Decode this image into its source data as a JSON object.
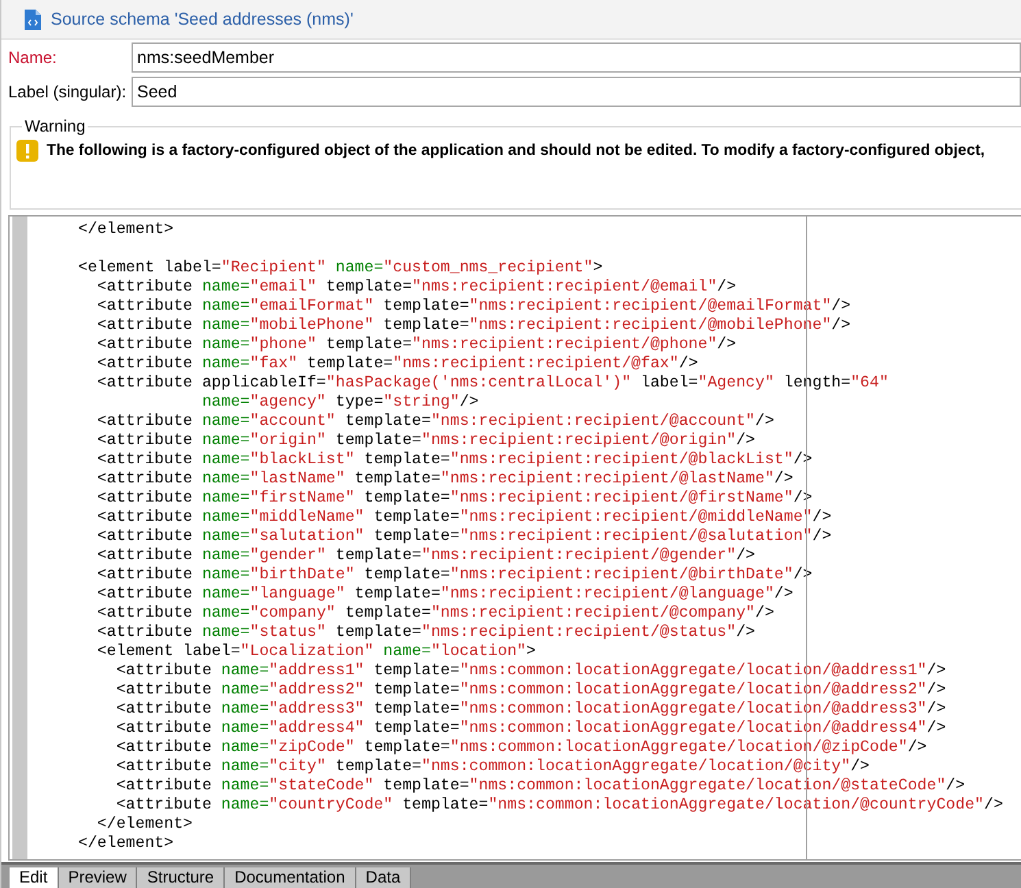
{
  "header": {
    "title": "Source schema 'Seed addresses (nms)'"
  },
  "fields": [
    {
      "label": "Name:",
      "value": "nms:seedMember",
      "required": true
    },
    {
      "label": "Label (singular):",
      "value": "Seed",
      "required": false
    }
  ],
  "warning": {
    "legend": "Warning",
    "message": "The following is a factory-configured object of the application and should not be edited. To modify a factory-configured object,"
  },
  "code_lines": [
    {
      "kind": "code",
      "segments": [
        {
          "text": "</element>",
          "kind": "tag"
        }
      ]
    },
    {
      "kind": "blank"
    },
    {
      "kind": "code",
      "segments": [
        {
          "text": "<element label=",
          "kind": "tag"
        },
        {
          "text": "\"Recipient\"",
          "kind": "value"
        },
        {
          "text": " name=",
          "kind": "name"
        },
        {
          "text": "\"custom_nms_recipient\"",
          "kind": "value"
        },
        {
          "text": ">",
          "kind": "tag"
        }
      ]
    },
    {
      "kind": "code",
      "segments": [
        {
          "text": "  <attribute ",
          "kind": "tag"
        },
        {
          "text": "name=",
          "kind": "name"
        },
        {
          "text": "\"email\"",
          "kind": "value"
        },
        {
          "text": " template=",
          "kind": "tag"
        },
        {
          "text": "\"nms:recipient:recipient/@email\"",
          "kind": "value"
        },
        {
          "text": "/>",
          "kind": "tag"
        }
      ]
    },
    {
      "kind": "code",
      "segments": [
        {
          "text": "  <attribute ",
          "kind": "tag"
        },
        {
          "text": "name=",
          "kind": "name"
        },
        {
          "text": "\"emailFormat\"",
          "kind": "value"
        },
        {
          "text": " template=",
          "kind": "tag"
        },
        {
          "text": "\"nms:recipient:recipient/@emailFormat\"",
          "kind": "value"
        },
        {
          "text": "/>",
          "kind": "tag"
        }
      ]
    },
    {
      "kind": "code",
      "segments": [
        {
          "text": "  <attribute ",
          "kind": "tag"
        },
        {
          "text": "name=",
          "kind": "name"
        },
        {
          "text": "\"mobilePhone\"",
          "kind": "value"
        },
        {
          "text": " template=",
          "kind": "tag"
        },
        {
          "text": "\"nms:recipient:recipient/@mobilePhone\"",
          "kind": "value"
        },
        {
          "text": "/>",
          "kind": "tag"
        }
      ]
    },
    {
      "kind": "code",
      "segments": [
        {
          "text": "  <attribute ",
          "kind": "tag"
        },
        {
          "text": "name=",
          "kind": "name"
        },
        {
          "text": "\"phone\"",
          "kind": "value"
        },
        {
          "text": " template=",
          "kind": "tag"
        },
        {
          "text": "\"nms:recipient:recipient/@phone\"",
          "kind": "value"
        },
        {
          "text": "/>",
          "kind": "tag"
        }
      ]
    },
    {
      "kind": "code",
      "segments": [
        {
          "text": "  <attribute ",
          "kind": "tag"
        },
        {
          "text": "name=",
          "kind": "name"
        },
        {
          "text": "\"fax\"",
          "kind": "value"
        },
        {
          "text": " template=",
          "kind": "tag"
        },
        {
          "text": "\"nms:recipient:recipient/@fax\"",
          "kind": "value"
        },
        {
          "text": "/>",
          "kind": "tag"
        }
      ]
    },
    {
      "kind": "code",
      "segments": [
        {
          "text": "  <attribute applicableIf=",
          "kind": "tag"
        },
        {
          "text": "\"hasPackage('nms:centralLocal')\"",
          "kind": "value"
        },
        {
          "text": " label=",
          "kind": "tag"
        },
        {
          "text": "\"Agency\"",
          "kind": "value"
        },
        {
          "text": " length=",
          "kind": "tag"
        },
        {
          "text": "\"64\"",
          "kind": "value"
        }
      ]
    },
    {
      "kind": "code",
      "segments": [
        {
          "text": "             name=",
          "kind": "name"
        },
        {
          "text": "\"agency\"",
          "kind": "value"
        },
        {
          "text": " type=",
          "kind": "tag"
        },
        {
          "text": "\"string\"",
          "kind": "value"
        },
        {
          "text": "/>",
          "kind": "tag"
        }
      ]
    },
    {
      "kind": "code",
      "segments": [
        {
          "text": "  <attribute ",
          "kind": "tag"
        },
        {
          "text": "name=",
          "kind": "name"
        },
        {
          "text": "\"account\"",
          "kind": "value"
        },
        {
          "text": " template=",
          "kind": "tag"
        },
        {
          "text": "\"nms:recipient:recipient/@account\"",
          "kind": "value"
        },
        {
          "text": "/>",
          "kind": "tag"
        }
      ]
    },
    {
      "kind": "code",
      "segments": [
        {
          "text": "  <attribute ",
          "kind": "tag"
        },
        {
          "text": "name=",
          "kind": "name"
        },
        {
          "text": "\"origin\"",
          "kind": "value"
        },
        {
          "text": " template=",
          "kind": "tag"
        },
        {
          "text": "\"nms:recipient:recipient/@origin\"",
          "kind": "value"
        },
        {
          "text": "/>",
          "kind": "tag"
        }
      ]
    },
    {
      "kind": "code",
      "segments": [
        {
          "text": "  <attribute ",
          "kind": "tag"
        },
        {
          "text": "name=",
          "kind": "name"
        },
        {
          "text": "\"blackList\"",
          "kind": "value"
        },
        {
          "text": " template=",
          "kind": "tag"
        },
        {
          "text": "\"nms:recipient:recipient/@blackList\"",
          "kind": "value"
        },
        {
          "text": "/>",
          "kind": "tag"
        }
      ]
    },
    {
      "kind": "code",
      "segments": [
        {
          "text": "  <attribute ",
          "kind": "tag"
        },
        {
          "text": "name=",
          "kind": "name"
        },
        {
          "text": "\"lastName\"",
          "kind": "value"
        },
        {
          "text": " template=",
          "kind": "tag"
        },
        {
          "text": "\"nms:recipient:recipient/@lastName\"",
          "kind": "value"
        },
        {
          "text": "/>",
          "kind": "tag"
        }
      ]
    },
    {
      "kind": "code",
      "segments": [
        {
          "text": "  <attribute ",
          "kind": "tag"
        },
        {
          "text": "name=",
          "kind": "name"
        },
        {
          "text": "\"firstName\"",
          "kind": "value"
        },
        {
          "text": " template=",
          "kind": "tag"
        },
        {
          "text": "\"nms:recipient:recipient/@firstName\"",
          "kind": "value"
        },
        {
          "text": "/>",
          "kind": "tag"
        }
      ]
    },
    {
      "kind": "code",
      "segments": [
        {
          "text": "  <attribute ",
          "kind": "tag"
        },
        {
          "text": "name=",
          "kind": "name"
        },
        {
          "text": "\"middleName\"",
          "kind": "value"
        },
        {
          "text": " template=",
          "kind": "tag"
        },
        {
          "text": "\"nms:recipient:recipient/@middleName\"",
          "kind": "value"
        },
        {
          "text": "/>",
          "kind": "tag"
        }
      ]
    },
    {
      "kind": "code",
      "segments": [
        {
          "text": "  <attribute ",
          "kind": "tag"
        },
        {
          "text": "name=",
          "kind": "name"
        },
        {
          "text": "\"salutation\"",
          "kind": "value"
        },
        {
          "text": " template=",
          "kind": "tag"
        },
        {
          "text": "\"nms:recipient:recipient/@salutation\"",
          "kind": "value"
        },
        {
          "text": "/>",
          "kind": "tag"
        }
      ]
    },
    {
      "kind": "code",
      "segments": [
        {
          "text": "  <attribute ",
          "kind": "tag"
        },
        {
          "text": "name=",
          "kind": "name"
        },
        {
          "text": "\"gender\"",
          "kind": "value"
        },
        {
          "text": " template=",
          "kind": "tag"
        },
        {
          "text": "\"nms:recipient:recipient/@gender\"",
          "kind": "value"
        },
        {
          "text": "/>",
          "kind": "tag"
        }
      ]
    },
    {
      "kind": "code",
      "segments": [
        {
          "text": "  <attribute ",
          "kind": "tag"
        },
        {
          "text": "name=",
          "kind": "name"
        },
        {
          "text": "\"birthDate\"",
          "kind": "value"
        },
        {
          "text": " template=",
          "kind": "tag"
        },
        {
          "text": "\"nms:recipient:recipient/@birthDate\"",
          "kind": "value"
        },
        {
          "text": "/>",
          "kind": "tag"
        }
      ]
    },
    {
      "kind": "code",
      "segments": [
        {
          "text": "  <attribute ",
          "kind": "tag"
        },
        {
          "text": "name=",
          "kind": "name"
        },
        {
          "text": "\"language\"",
          "kind": "value"
        },
        {
          "text": " template=",
          "kind": "tag"
        },
        {
          "text": "\"nms:recipient:recipient/@language\"",
          "kind": "value"
        },
        {
          "text": "/>",
          "kind": "tag"
        }
      ]
    },
    {
      "kind": "code",
      "segments": [
        {
          "text": "  <attribute ",
          "kind": "tag"
        },
        {
          "text": "name=",
          "kind": "name"
        },
        {
          "text": "\"company\"",
          "kind": "value"
        },
        {
          "text": " template=",
          "kind": "tag"
        },
        {
          "text": "\"nms:recipient:recipient/@company\"",
          "kind": "value"
        },
        {
          "text": "/>",
          "kind": "tag"
        }
      ]
    },
    {
      "kind": "code",
      "segments": [
        {
          "text": "  <attribute ",
          "kind": "tag"
        },
        {
          "text": "name=",
          "kind": "name"
        },
        {
          "text": "\"status\"",
          "kind": "value"
        },
        {
          "text": " template=",
          "kind": "tag"
        },
        {
          "text": "\"nms:recipient:recipient/@status\"",
          "kind": "value"
        },
        {
          "text": "/>",
          "kind": "tag"
        }
      ]
    },
    {
      "kind": "code",
      "segments": [
        {
          "text": "  <element label=",
          "kind": "tag"
        },
        {
          "text": "\"Localization\"",
          "kind": "value"
        },
        {
          "text": " name=",
          "kind": "name"
        },
        {
          "text": "\"location\"",
          "kind": "value"
        },
        {
          "text": ">",
          "kind": "tag"
        }
      ]
    },
    {
      "kind": "code",
      "segments": [
        {
          "text": "    <attribute ",
          "kind": "tag"
        },
        {
          "text": "name=",
          "kind": "name"
        },
        {
          "text": "\"address1\"",
          "kind": "value"
        },
        {
          "text": " template=",
          "kind": "tag"
        },
        {
          "text": "\"nms:common:locationAggregate/location/@address1\"",
          "kind": "value"
        },
        {
          "text": "/>",
          "kind": "tag"
        }
      ]
    },
    {
      "kind": "code",
      "segments": [
        {
          "text": "    <attribute ",
          "kind": "tag"
        },
        {
          "text": "name=",
          "kind": "name"
        },
        {
          "text": "\"address2\"",
          "kind": "value"
        },
        {
          "text": " template=",
          "kind": "tag"
        },
        {
          "text": "\"nms:common:locationAggregate/location/@address2\"",
          "kind": "value"
        },
        {
          "text": "/>",
          "kind": "tag"
        }
      ]
    },
    {
      "kind": "code",
      "segments": [
        {
          "text": "    <attribute ",
          "kind": "tag"
        },
        {
          "text": "name=",
          "kind": "name"
        },
        {
          "text": "\"address3\"",
          "kind": "value"
        },
        {
          "text": " template=",
          "kind": "tag"
        },
        {
          "text": "\"nms:common:locationAggregate/location/@address3\"",
          "kind": "value"
        },
        {
          "text": "/>",
          "kind": "tag"
        }
      ]
    },
    {
      "kind": "code",
      "segments": [
        {
          "text": "    <attribute ",
          "kind": "tag"
        },
        {
          "text": "name=",
          "kind": "name"
        },
        {
          "text": "\"address4\"",
          "kind": "value"
        },
        {
          "text": " template=",
          "kind": "tag"
        },
        {
          "text": "\"nms:common:locationAggregate/location/@address4\"",
          "kind": "value"
        },
        {
          "text": "/>",
          "kind": "tag"
        }
      ]
    },
    {
      "kind": "code",
      "segments": [
        {
          "text": "    <attribute ",
          "kind": "tag"
        },
        {
          "text": "name=",
          "kind": "name"
        },
        {
          "text": "\"zipCode\"",
          "kind": "value"
        },
        {
          "text": " template=",
          "kind": "tag"
        },
        {
          "text": "\"nms:common:locationAggregate/location/@zipCode\"",
          "kind": "value"
        },
        {
          "text": "/>",
          "kind": "tag"
        }
      ]
    },
    {
      "kind": "code",
      "segments": [
        {
          "text": "    <attribute ",
          "kind": "tag"
        },
        {
          "text": "name=",
          "kind": "name"
        },
        {
          "text": "\"city\"",
          "kind": "value"
        },
        {
          "text": " template=",
          "kind": "tag"
        },
        {
          "text": "\"nms:common:locationAggregate/location/@city\"",
          "kind": "value"
        },
        {
          "text": "/>",
          "kind": "tag"
        }
      ]
    },
    {
      "kind": "code",
      "segments": [
        {
          "text": "    <attribute ",
          "kind": "tag"
        },
        {
          "text": "name=",
          "kind": "name"
        },
        {
          "text": "\"stateCode\"",
          "kind": "value"
        },
        {
          "text": " template=",
          "kind": "tag"
        },
        {
          "text": "\"nms:common:locationAggregate/location/@stateCode\"",
          "kind": "value"
        },
        {
          "text": "/>",
          "kind": "tag"
        }
      ]
    },
    {
      "kind": "code",
      "segments": [
        {
          "text": "    <attribute ",
          "kind": "tag"
        },
        {
          "text": "name=",
          "kind": "name"
        },
        {
          "text": "\"countryCode\"",
          "kind": "value"
        },
        {
          "text": " template=",
          "kind": "tag"
        },
        {
          "text": "\"nms:common:locationAggregate/location/@countryCode\"",
          "kind": "value"
        },
        {
          "text": "/>",
          "kind": "tag"
        }
      ]
    },
    {
      "kind": "code",
      "segments": [
        {
          "text": "  </element>",
          "kind": "tag"
        }
      ]
    },
    {
      "kind": "code",
      "segments": [
        {
          "text": "</element>",
          "kind": "tag"
        }
      ]
    }
  ],
  "tabs": [
    {
      "label": "Edit",
      "selected": true
    },
    {
      "label": "Preview",
      "selected": false
    },
    {
      "label": "Structure",
      "selected": false
    },
    {
      "label": "Documentation",
      "selected": false
    },
    {
      "label": "Data",
      "selected": false
    }
  ]
}
